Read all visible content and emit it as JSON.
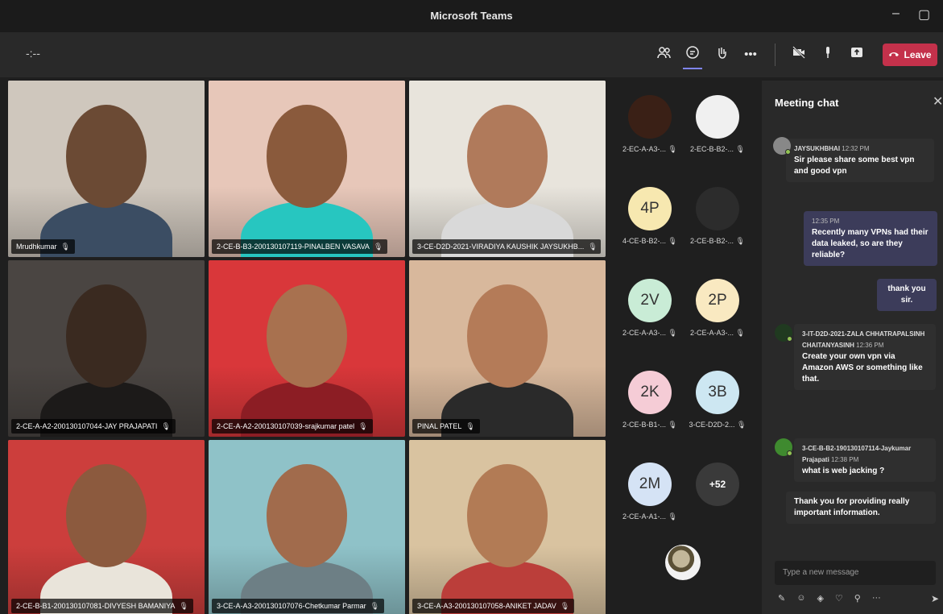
{
  "window": {
    "title": "Microsoft Teams",
    "minimize": "–",
    "maximize": "▢"
  },
  "toolbar": {
    "timer": "-:--",
    "leave_label": "Leave"
  },
  "tiles": [
    {
      "name": "Mrudhkumar",
      "bg": "#cfc7bd",
      "skin": "#6b4a34",
      "shirt": "#3b4d63",
      "speaking": true
    },
    {
      "name": "2-CE-B-B3-200130107119-PINALBEN VASAVA",
      "bg": "#e7c7b9",
      "skin": "#8a5a3c",
      "shirt": "#27c6c0",
      "speaking": false
    },
    {
      "name": "3-CE-D2D-2021-VIRADIYA KAUSHIK JAYSUKHB...",
      "bg": "#e8e4dc",
      "skin": "#b07a5b",
      "shirt": "#d9d9d9",
      "speaking": false
    },
    {
      "name": "2-CE-A-A2-200130107044-JAY PRAJAPATI",
      "bg": "#4a4542",
      "skin": "#3a2a20",
      "shirt": "#1c1a19",
      "speaking": false
    },
    {
      "name": "2-CE-A-A2-200130107039-srajkumar patel",
      "bg": "#d9373a",
      "skin": "#a8714f",
      "shirt": "#8c1d24",
      "speaking": false
    },
    {
      "name": "PINAL PATEL",
      "bg": "#d8b89c",
      "skin": "#b47b58",
      "shirt": "#2a2a2a",
      "speaking": true
    },
    {
      "name": "2-CE-B-B1-200130107081-DIVYESH BAMANIYA",
      "bg": "#cc3e3c",
      "skin": "#8c5a3e",
      "shirt": "#e9e4da",
      "speaking": false
    },
    {
      "name": "3-CE-A-A3-200130107076-Chetkumar Parmar",
      "bg": "#8fc2c8",
      "skin": "#a16b4c",
      "shirt": "#6d7f85",
      "speaking": false
    },
    {
      "name": "3-CE-A-A3-200130107058-ANIKET JADAV",
      "bg": "#d9c3a0",
      "skin": "#b27b55",
      "shirt": "#bb3e3a",
      "speaking": false
    }
  ],
  "participants": [
    {
      "label": "2-EC-A-A3-...",
      "initials": "",
      "avatar": "#3a2016"
    },
    {
      "label": "2-EC-B-B2-...",
      "initials": "",
      "avatar": "#f0f0f0"
    },
    {
      "label": "4-CE-B-B2-...",
      "initials": "4P",
      "avatar": "#f7e8b0"
    },
    {
      "label": "2-CE-B-B2-...",
      "initials": "",
      "avatar": "#2c2c2c"
    },
    {
      "label": "2-CE-A-A3-...",
      "initials": "2V",
      "avatar": "#c9ecd6"
    },
    {
      "label": "2-CE-A-A3-...",
      "initials": "2P",
      "avatar": "#f9e9c1"
    },
    {
      "label": "2-CE-B-B1-...",
      "initials": "2K",
      "avatar": "#f5ccd6"
    },
    {
      "label": "3-CE-D2D-2...",
      "initials": "3B",
      "avatar": "#cde7f2"
    },
    {
      "label": "2-CE-A-A1-...",
      "initials": "2M",
      "avatar": "#d5e3f5"
    },
    {
      "label": "",
      "initials": "+52",
      "avatar": "#3a3a3a"
    }
  ],
  "chat": {
    "header": "Meeting chat",
    "messages": [
      {
        "sender": "JAYSUKHBHAI",
        "time": "12:32 PM",
        "text": "Sir please share some best vpn and good vpn"
      },
      {
        "sender": "",
        "time": "12:35 PM",
        "text": "Recently many VPNs had their data leaked, so are they reliable?"
      },
      {
        "sender": "",
        "time": "",
        "text": "thank you sir."
      },
      {
        "sender": "3-IT-D2D-2021-ZALA CHHATRAPALSINH CHAITANYASINH",
        "time": "12:36 PM",
        "text": "Create your own vpn via Amazon AWS or something like that."
      },
      {
        "sender": "3-CE-B-B2-190130107114-Jaykumar Prajapati",
        "time": "12:38 PM",
        "text": "what is web jacking ?"
      },
      {
        "sender": "",
        "time": "",
        "text": "Thank you for providing really important information."
      }
    ],
    "compose_placeholder": "Type a new message"
  },
  "colors": {
    "accent": "#7f85f5",
    "leave": "#c4314b",
    "panel": "#292929",
    "stage": "#1f1f1f"
  },
  "icons": [
    "people-icon",
    "chat-icon",
    "reactions-icon",
    "more-icon",
    "camera-off-icon",
    "mic-icon",
    "share-icon",
    "phone-icon"
  ]
}
